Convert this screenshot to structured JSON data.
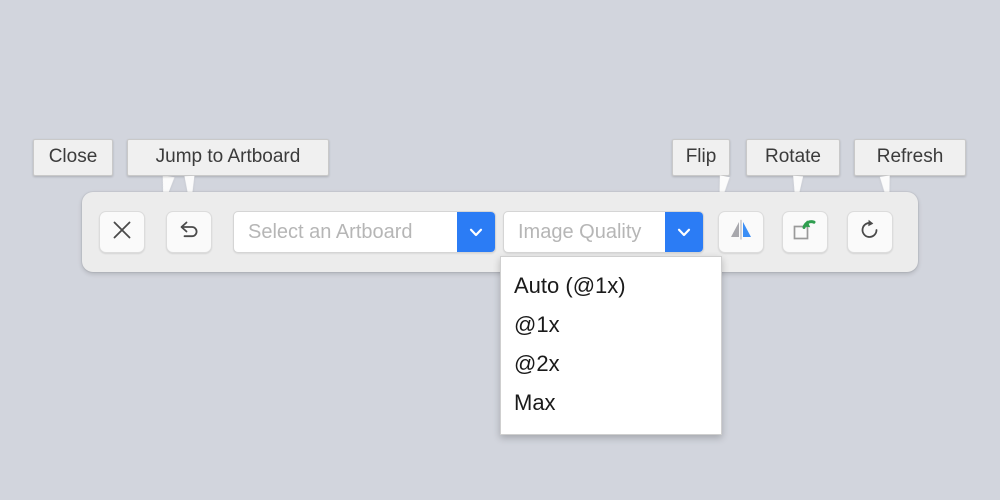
{
  "callouts": [
    {
      "label": "Close",
      "name": "callout-close"
    },
    {
      "label": "Jump to Artboard",
      "name": "callout-jump-to-artboard"
    },
    {
      "label": "Flip",
      "name": "callout-flip"
    },
    {
      "label": "Rotate",
      "name": "callout-rotate"
    },
    {
      "label": "Refresh",
      "name": "callout-refresh"
    }
  ],
  "toolbar": {
    "close_button": {
      "icon": "close-x-icon"
    },
    "jump_button": {
      "icon": "undo-arrow-icon"
    },
    "artboard_select": {
      "value": "Select an Artboard",
      "arrow_icon": "chevron-down-icon"
    },
    "quality_select": {
      "value": "Image Quality",
      "arrow_icon": "chevron-down-icon"
    },
    "flip_button": {
      "icon": "flip-horizontal-icon"
    },
    "rotate_button": {
      "icon": "rotate-square-icon"
    },
    "refresh_button": {
      "icon": "refresh-circular-arrow-icon"
    }
  },
  "quality_menu": {
    "items": [
      {
        "label": "Auto (@1x)"
      },
      {
        "label": "@1x"
      },
      {
        "label": "@2x"
      },
      {
        "label": "Max"
      }
    ]
  },
  "colors": {
    "background": "#d2d5dd",
    "toolbar": "#ececec",
    "accent_blue": "#2b7cf5",
    "rotate_green": "#2f9e4f",
    "flip_gray": "#a8a8ad"
  }
}
